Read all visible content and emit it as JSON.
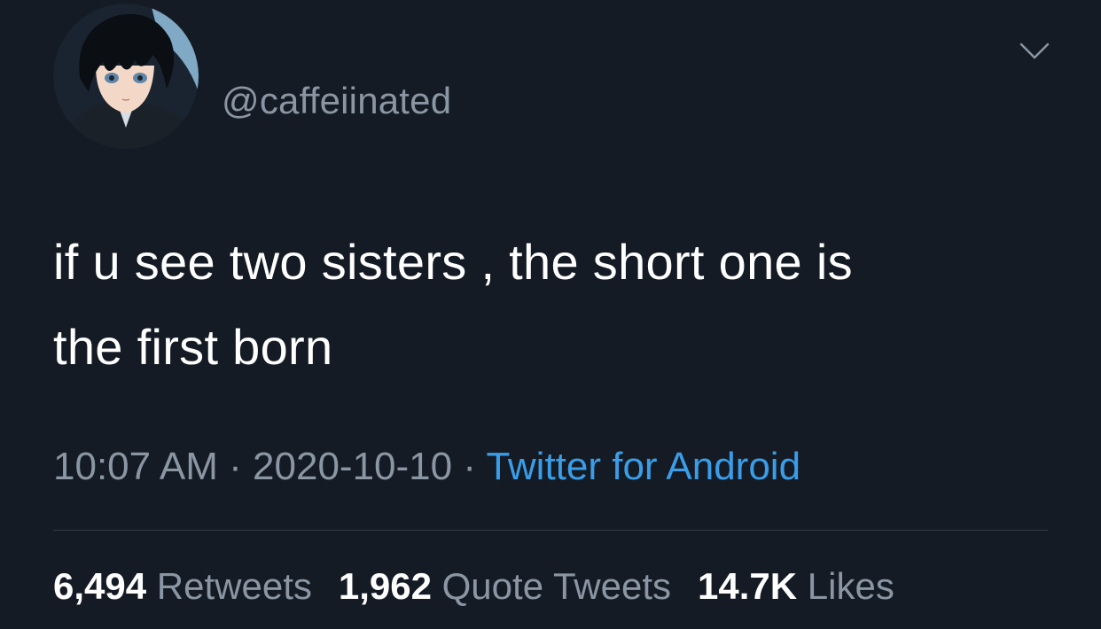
{
  "tweet": {
    "handle": "@caffeiinated",
    "text_line1": "if u see two sisters , the short one is",
    "text_line2": "the first born",
    "time": "10:07 AM",
    "separator": "·",
    "date": "2020-10-10",
    "source": "Twitter for Android"
  },
  "stats": {
    "retweets_count": "6,494",
    "retweets_label": "Retweets",
    "quotes_count": "1,962",
    "quotes_label": "Quote Tweets",
    "likes_count": "14.7K",
    "likes_label": "Likes"
  },
  "icons": {
    "menu": "chevron-down-icon",
    "avatar": "avatar-image"
  },
  "colors": {
    "background": "#151b24",
    "text": "#ffffff",
    "secondary": "#8a96a3",
    "link": "#3a9de8"
  }
}
